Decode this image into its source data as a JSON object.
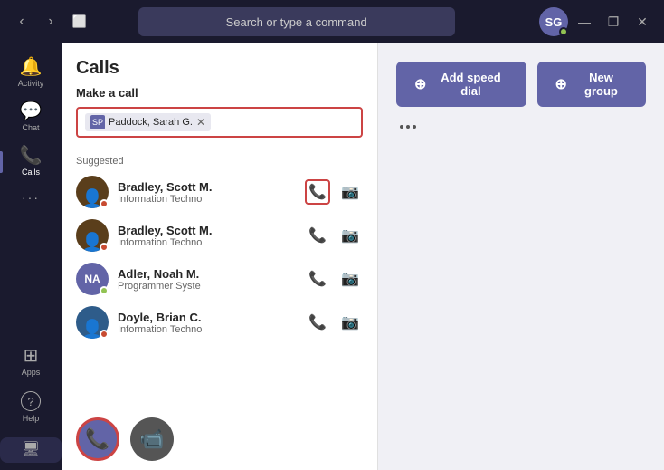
{
  "titlebar": {
    "search_placeholder": "Search or type a command",
    "back_label": "‹",
    "forward_label": "›",
    "new_window_label": "⬜",
    "minimize_label": "—",
    "maximize_label": "❐",
    "close_label": "✕",
    "avatar_initials": "SG"
  },
  "sidebar": {
    "items": [
      {
        "id": "activity",
        "label": "Activity",
        "icon": "🔔"
      },
      {
        "id": "chat",
        "label": "Chat",
        "icon": "💬"
      },
      {
        "id": "calls",
        "label": "Calls",
        "icon": "📞"
      },
      {
        "id": "more",
        "label": "...",
        "icon": "···"
      },
      {
        "id": "apps",
        "label": "Apps",
        "icon": "⊞"
      },
      {
        "id": "help",
        "label": "Help",
        "icon": "?"
      }
    ]
  },
  "calls_panel": {
    "header": "Calls",
    "make_call_title": "Make a call",
    "search_tag_initials": "SP",
    "search_tag_name": "Paddock, Sarah G.",
    "search_tag_close": "✕",
    "suggested_label": "Suggested",
    "contacts": [
      {
        "id": "c1",
        "name": "Bradley, Scott M.",
        "dept": "Information Techno",
        "status": "red",
        "highlight_phone": true
      },
      {
        "id": "c2",
        "name": "Bradley, Scott M.",
        "dept": "Information Techno",
        "status": "red",
        "highlight_phone": false
      },
      {
        "id": "c3",
        "name": "Adler, Noah M.",
        "dept": "Programmer Syste",
        "status": "green",
        "initials": "NA",
        "highlight_phone": false
      },
      {
        "id": "c4",
        "name": "Doyle, Brian C.",
        "dept": "Information Techno",
        "status": "red",
        "highlight_phone": false
      }
    ]
  },
  "dial_buttons": {
    "phone_label": "📞",
    "video_label": "📹"
  },
  "right_panel": {
    "add_speed_dial_label": "Add speed dial",
    "new_group_label": "New group",
    "more_options_label": "···"
  }
}
